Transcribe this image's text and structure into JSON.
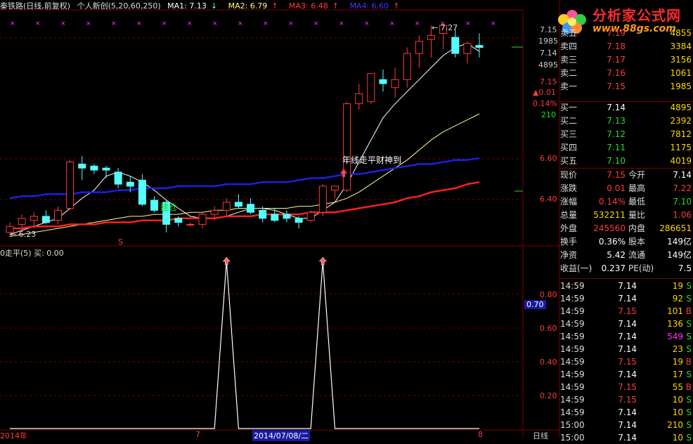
{
  "header": {
    "title": "秦铁路(日线,前复权)",
    "indicator": "个人新创(5,20,60,250)",
    "ma1": "MA1: 7.13",
    "ma2": "MA2: 6.79",
    "ma3": "MA3: 6.48",
    "ma4": "MA4: 6.60",
    "down_arrow": "↓",
    "up_arrow": "↑"
  },
  "sub_header": "0走平(5)  买: 0.00",
  "annotations": {
    "high": "7.27",
    "low": "6.23",
    "signal_text": "年线走平财神到",
    "build_text": "建仓",
    "s_mark": "S"
  },
  "price_scale": {
    "top_value": "7.15",
    "vol_a": "1985",
    "vol_b": "4895",
    "mid_value": "7.14",
    "last": "7.15",
    "change": "▲0.01",
    "pct": "0.14%",
    "volnum": "210",
    "l660": "6.60",
    "l640": "6.40"
  },
  "ind_scale": [
    "0.80",
    "0.60",
    "0.40",
    "0.20"
  ],
  "ind_current": "0.70",
  "x_axis": {
    "left": "2014年",
    "mid": "7",
    "cursor": "2014/07/08/二",
    "right": "8",
    "period": "日线"
  },
  "logo": {
    "title": "分析家公式网",
    "url": "www.88gs.com"
  },
  "order_book": {
    "asks": [
      {
        "label": "卖五",
        "price": "7.19",
        "vol": "4855"
      },
      {
        "label": "卖四",
        "price": "7.18",
        "vol": "3384"
      },
      {
        "label": "卖三",
        "price": "7.17",
        "vol": "3156"
      },
      {
        "label": "卖二",
        "price": "7.16",
        "vol": "1061"
      },
      {
        "label": "卖一",
        "price": "7.15",
        "vol": "1985"
      }
    ],
    "bids": [
      {
        "label": "买一",
        "price": "7.14",
        "vol": "4895"
      },
      {
        "label": "买二",
        "price": "7.13",
        "vol": "2392"
      },
      {
        "label": "买三",
        "price": "7.12",
        "vol": "7812"
      },
      {
        "label": "买四",
        "price": "7.11",
        "vol": "1175"
      },
      {
        "label": "买五",
        "price": "7.10",
        "vol": "4019"
      }
    ]
  },
  "stats": [
    {
      "l1": "现价",
      "v1": "7.15",
      "l2": "今开",
      "v2": "7.14"
    },
    {
      "l1": "涨跌",
      "v1": "0.01",
      "l2": "最高",
      "v2": "7.22"
    },
    {
      "l1": "涨幅",
      "v1": "0.14%",
      "l2": "最低",
      "v2": "7.10"
    },
    {
      "l1": "总量",
      "v1": "532211",
      "l2": "量比",
      "v2": "1.06"
    },
    {
      "l1": "外盘",
      "v1": "245560",
      "l2": "内盘",
      "v2": "286651"
    },
    {
      "l1": "换手",
      "v1": "0.36%",
      "l2": "股本",
      "v2": "149亿"
    },
    {
      "l1": "净资",
      "v1": "5.42",
      "l2": "流通",
      "v2": "149亿"
    },
    {
      "l1": "收益(一)",
      "v1": "0.237",
      "l2": "PE(动)",
      "v2": "7.5"
    }
  ],
  "ticks": [
    {
      "t": "14:59",
      "p": "7.14",
      "v": "19",
      "s": "S"
    },
    {
      "t": "14:59",
      "p": "7.14",
      "v": "92",
      "s": "S"
    },
    {
      "t": "14:59",
      "p": "7.15",
      "v": "101",
      "s": "B"
    },
    {
      "t": "14:59",
      "p": "7.14",
      "v": "136",
      "s": "S"
    },
    {
      "t": "14:59",
      "p": "7.14",
      "v": "549",
      "s": "S"
    },
    {
      "t": "14:59",
      "p": "7.14",
      "v": "23",
      "s": "S"
    },
    {
      "t": "14:59",
      "p": "7.15",
      "v": "19",
      "s": "B"
    },
    {
      "t": "14:59",
      "p": "7.14",
      "v": "17",
      "s": "S"
    },
    {
      "t": "14:59",
      "p": "7.15",
      "v": "55",
      "s": "B"
    },
    {
      "t": "14:59",
      "p": "7.15",
      "v": "10",
      "s": "S"
    },
    {
      "t": "14:59",
      "p": "7.14",
      "v": "10",
      "s": "S"
    },
    {
      "t": "15:00",
      "p": "7.14",
      "v": "210",
      "s": "S"
    },
    {
      "t": "15:00",
      "p": "7.14",
      "v": "10",
      "s": "S"
    }
  ],
  "colors": {
    "up": "#ff3b3b",
    "down": "#54ffff",
    "ma5": "#ffffff",
    "ma20": "#ffff80",
    "ma60": "#1e1ee6",
    "ma250": "#ff2020",
    "grid": "#7a0000",
    "green": "#20e020",
    "purple": "#ff33ff"
  },
  "chart_data": [
    {
      "type": "candlestick",
      "ylim": [
        6.17,
        7.33
      ],
      "series": [
        {
          "name": "K",
          "ohlc": [
            [
              6.23,
              6.28,
              6.21,
              6.26
            ],
            [
              6.27,
              6.32,
              6.24,
              6.3
            ],
            [
              6.29,
              6.33,
              6.25,
              6.31
            ],
            [
              6.31,
              6.34,
              6.27,
              6.28
            ],
            [
              6.29,
              6.36,
              6.27,
              6.34
            ],
            [
              6.35,
              6.59,
              6.34,
              6.58
            ],
            [
              6.57,
              6.61,
              6.49,
              6.55
            ],
            [
              6.56,
              6.57,
              6.52,
              6.54
            ],
            [
              6.55,
              6.56,
              6.5,
              6.54
            ],
            [
              6.53,
              6.55,
              6.45,
              6.47
            ],
            [
              6.48,
              6.51,
              6.43,
              6.46
            ],
            [
              6.49,
              6.52,
              6.36,
              6.37
            ],
            [
              6.39,
              6.41,
              6.33,
              6.34
            ],
            [
              6.38,
              6.39,
              6.23,
              6.27
            ],
            [
              6.3,
              6.31,
              6.26,
              6.28
            ],
            [
              6.27,
              6.28,
              6.26,
              6.27
            ],
            [
              6.27,
              6.33,
              6.25,
              6.32
            ],
            [
              6.32,
              6.36,
              6.29,
              6.34
            ],
            [
              6.34,
              6.4,
              6.31,
              6.38
            ],
            [
              6.38,
              6.42,
              6.35,
              6.36
            ],
            [
              6.37,
              6.4,
              6.32,
              6.33
            ],
            [
              6.34,
              6.36,
              6.28,
              6.3
            ],
            [
              6.32,
              6.35,
              6.28,
              6.29
            ],
            [
              6.32,
              6.34,
              6.28,
              6.3
            ],
            [
              6.3,
              6.31,
              6.25,
              6.28
            ],
            [
              6.29,
              6.34,
              6.28,
              6.33
            ],
            [
              6.33,
              6.47,
              6.31,
              6.46
            ],
            [
              6.44,
              6.46,
              6.4,
              6.46
            ],
            [
              6.44,
              6.88,
              6.43,
              6.87
            ],
            [
              6.87,
              6.97,
              6.84,
              6.92
            ],
            [
              6.88,
              7.02,
              6.87,
              7.02
            ],
            [
              6.99,
              7.04,
              6.93,
              6.97
            ],
            [
              6.95,
              7.05,
              6.9,
              6.99
            ],
            [
              6.99,
              7.15,
              6.95,
              7.12
            ],
            [
              7.12,
              7.21,
              7.05,
              7.18
            ],
            [
              7.19,
              7.26,
              7.1,
              7.21
            ],
            [
              7.22,
              7.27,
              7.14,
              7.26
            ],
            [
              7.2,
              7.24,
              7.1,
              7.12
            ],
            [
              7.12,
              7.18,
              7.07,
              7.17
            ],
            [
              7.16,
              7.22,
              7.1,
              7.15
            ]
          ]
        },
        {
          "name": "MA5",
          "values": [
            6.22,
            6.24,
            6.26,
            6.28,
            6.3,
            6.35,
            6.4,
            6.44,
            6.51,
            6.53,
            6.51,
            6.48,
            6.44,
            6.39,
            6.35,
            6.31,
            6.3,
            6.3,
            6.31,
            6.33,
            6.35,
            6.35,
            6.34,
            6.32,
            6.3,
            6.3,
            6.34,
            6.38,
            6.47,
            6.58,
            6.69,
            6.8,
            6.87,
            6.93,
            6.99,
            7.05,
            7.11,
            7.15,
            7.17,
            7.13
          ]
        },
        {
          "name": "MA20",
          "values": [
            6.21,
            6.22,
            6.23,
            6.24,
            6.25,
            6.26,
            6.27,
            6.28,
            6.29,
            6.3,
            6.31,
            6.31,
            6.32,
            6.32,
            6.32,
            6.33,
            6.33,
            6.34,
            6.34,
            6.35,
            6.35,
            6.35,
            6.35,
            6.35,
            6.36,
            6.36,
            6.37,
            6.38,
            6.4,
            6.43,
            6.47,
            6.51,
            6.55,
            6.59,
            6.64,
            6.69,
            6.73,
            6.76,
            6.79,
            6.82
          ]
        },
        {
          "name": "MA60",
          "values": [
            6.4,
            6.41,
            6.41,
            6.42,
            6.42,
            6.42,
            6.43,
            6.43,
            6.43,
            6.44,
            6.44,
            6.45,
            6.45,
            6.45,
            6.46,
            6.46,
            6.46,
            6.46,
            6.47,
            6.47,
            6.47,
            6.48,
            6.48,
            6.48,
            6.49,
            6.5,
            6.5,
            6.51,
            6.52,
            6.52,
            6.53,
            6.54,
            6.55,
            6.56,
            6.57,
            6.57,
            6.58,
            6.59,
            6.59,
            6.6
          ]
        },
        {
          "name": "MA250",
          "values": [
            6.25,
            6.25,
            6.26,
            6.26,
            6.26,
            6.27,
            6.27,
            6.27,
            6.28,
            6.28,
            6.28,
            6.29,
            6.29,
            6.29,
            6.3,
            6.3,
            6.3,
            6.3,
            6.31,
            6.31,
            6.31,
            6.32,
            6.32,
            6.32,
            6.32,
            6.33,
            6.33,
            6.33,
            6.34,
            6.35,
            6.36,
            6.37,
            6.38,
            6.4,
            6.41,
            6.43,
            6.44,
            6.45,
            6.47,
            6.48
          ]
        }
      ]
    },
    {
      "type": "line",
      "ylim": [
        0,
        1
      ],
      "series": [
        {
          "values": [
            0,
            0,
            0,
            0,
            0,
            0,
            0,
            0,
            0,
            0,
            0,
            0,
            0,
            0,
            0,
            0,
            0,
            0,
            1,
            0,
            0,
            0,
            0,
            0,
            0,
            0,
            1,
            0,
            0,
            0,
            0,
            0,
            0,
            0,
            0,
            0,
            0,
            0,
            0,
            0
          ]
        }
      ]
    }
  ]
}
